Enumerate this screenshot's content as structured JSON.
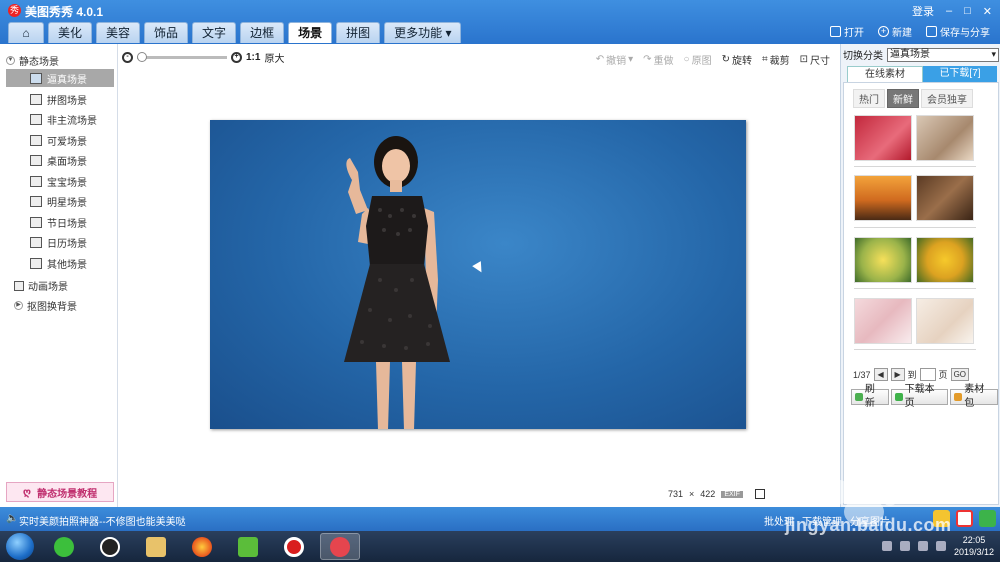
{
  "app": {
    "title": "美图秀秀 4.0.1",
    "login_label": "登录",
    "window_controls": [
      "–",
      "□",
      "✕"
    ]
  },
  "tabs": [
    {
      "label": "",
      "icon": "home-icon"
    },
    {
      "label": "美化"
    },
    {
      "label": "美容"
    },
    {
      "label": "饰品"
    },
    {
      "label": "文字"
    },
    {
      "label": "边框"
    },
    {
      "label": "场景",
      "active": true
    },
    {
      "label": "拼图"
    },
    {
      "label": "更多功能 ▾"
    }
  ],
  "top_actions": {
    "open": "打开",
    "new": "新建",
    "save_share": "保存与分享"
  },
  "sidebar": {
    "static_group": "静态场景",
    "items": [
      {
        "label": "逼真场景",
        "active": true
      },
      {
        "label": "拼图场景"
      },
      {
        "label": "非主流场景"
      },
      {
        "label": "可爱场景"
      },
      {
        "label": "桌面场景"
      },
      {
        "label": "宝宝场景"
      },
      {
        "label": "明星场景"
      },
      {
        "label": "节日场景"
      },
      {
        "label": "日历场景"
      },
      {
        "label": "其他场景"
      }
    ],
    "animated_group": "动画场景",
    "cutout_group": "抠图换背景",
    "tutorial_label": "静态场景教程"
  },
  "zoom": {
    "one_to_one": "1:1",
    "original_size": "原大",
    "level": 0.0
  },
  "edit_tools": {
    "undo": "撤销",
    "redo": "重做",
    "original": "原图",
    "rotate": "旋转",
    "crop": "裁剪",
    "resize": "尺寸"
  },
  "image_info": {
    "width": "731",
    "times": "×",
    "height": "422",
    "exif": "EXIF"
  },
  "right_panel": {
    "category_label": "切换分类",
    "category_value": "逼真场景",
    "tab_online": "在线素材",
    "tab_downloaded": "已下载[7]",
    "filters": [
      {
        "label": "热门"
      },
      {
        "label": "新鲜",
        "active": true
      },
      {
        "label": "会员独享"
      }
    ],
    "pager": {
      "current": "1/37",
      "prev": "◀",
      "next": "▶",
      "goto_label": "到",
      "page_unit": "页",
      "go": "GO"
    },
    "actions": {
      "refresh": "刷新",
      "download_page": "下载本页",
      "material_pack": "素材包"
    }
  },
  "status_bar": {
    "speaker": "🔈",
    "text": "实时美颜拍照神器--不修图也能美美哒",
    "batch": "批处理",
    "download_mgr": "下载管理",
    "share_image": "分享图片"
  },
  "taskbar": {
    "clock_time": "22:05",
    "clock_date": "2019/3/12"
  },
  "watermark": {
    "text": "jingyan.baidu.com"
  },
  "colors": {
    "title_blue": "#2a74cd",
    "photo_bg": "#2466a8",
    "tutorial_pink": "#c0306f",
    "tab_accent": "#3aa0e6"
  }
}
